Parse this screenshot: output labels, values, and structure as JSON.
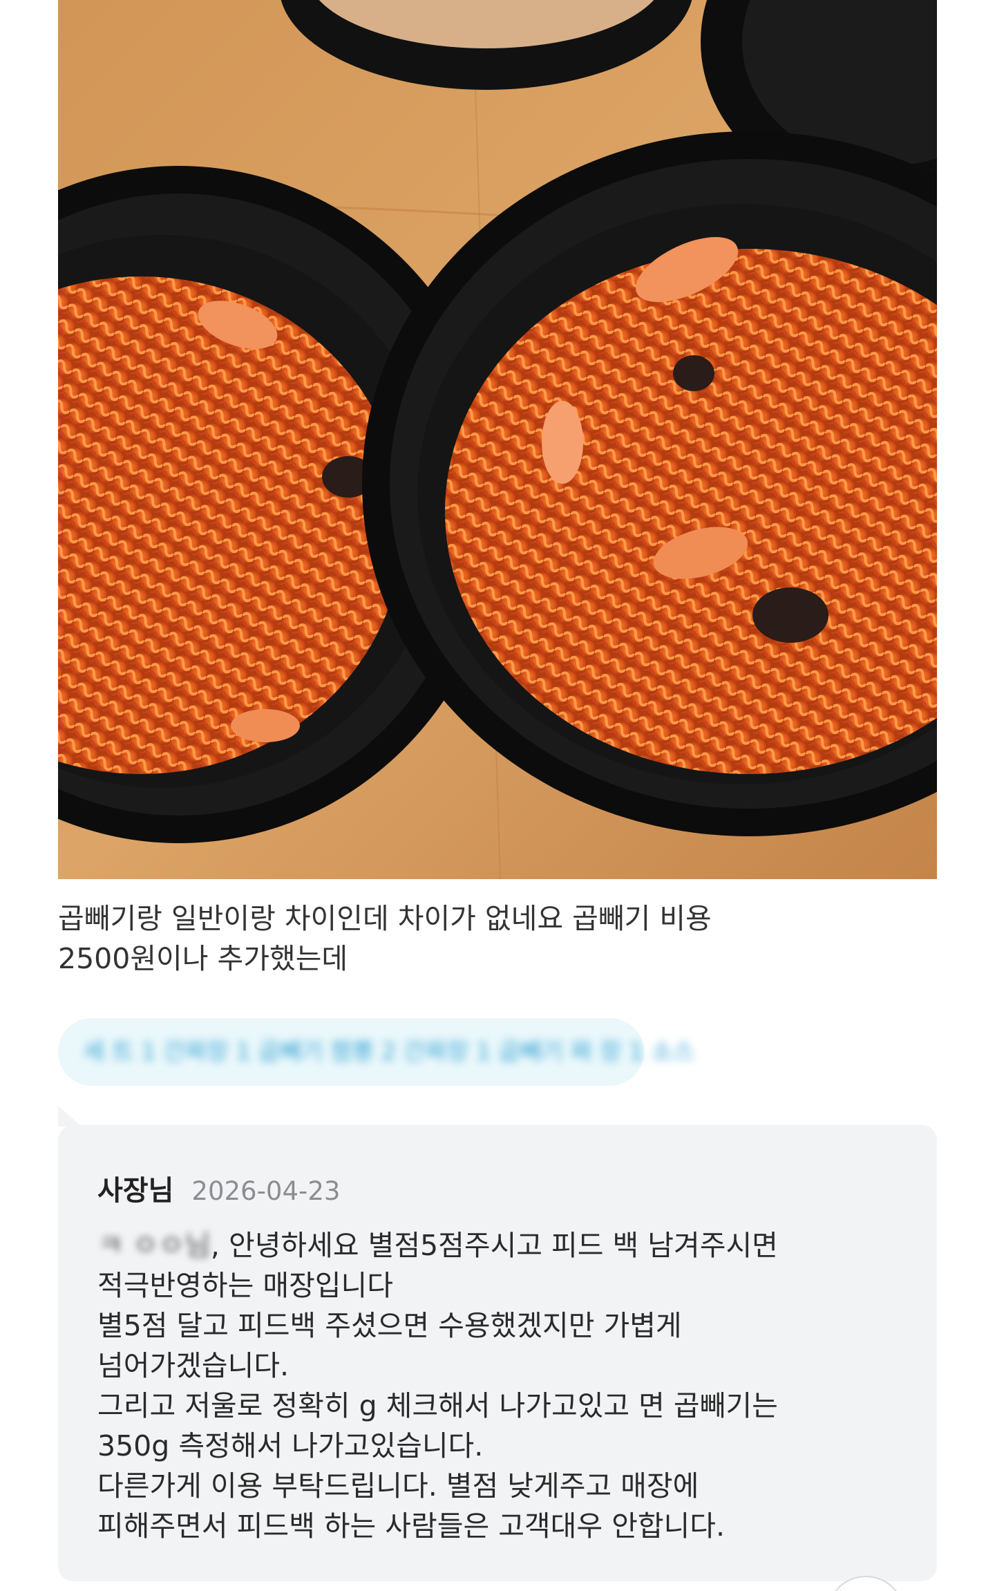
{
  "photo": {
    "alt": "",
    "icon": "food-photo"
  },
  "review": {
    "line1": "곱빼기랑 일반이랑 차이인데 차이가 없네요 곱빼기 비용",
    "line2": "2500원이나 추가했는데"
  },
  "menu_tag": {
    "text": "세 트 1 간짜장 1 곱빼기 짬뽕 2 간짜장 1 곱빼기 짜 장 1 소스"
  },
  "owner_reply": {
    "author": "사장님",
    "date": "2026-04-23",
    "customer_name_masked": "ㅋ ㅇㅇ님",
    "lines": [
      ", 안녕하세요  별점5점주시고 피드 백 남겨주시면",
      "적극반영하는 매장입니다",
      "별5점 달고 피드백 주셨으면 수용했겠지만 가볍게",
      "넘어가겠습니다.",
      "그리고 저울로 정확히 g 체크해서 나가고있고 면 곱빼기는",
      "350g 측정해서 나가고있습니다.",
      "다른가게 이용 부탁드립니다. 별점 낮게주고 매장에",
      "피해주면서 피드백 하는 사람들은 고객대우 안합니다."
    ]
  },
  "colors": {
    "menu_pill_bg": "#eaf8fb",
    "menu_pill_text": "#3aa5d6",
    "reply_bg": "#f2f3f5",
    "date_gray": "#8a8d92"
  }
}
